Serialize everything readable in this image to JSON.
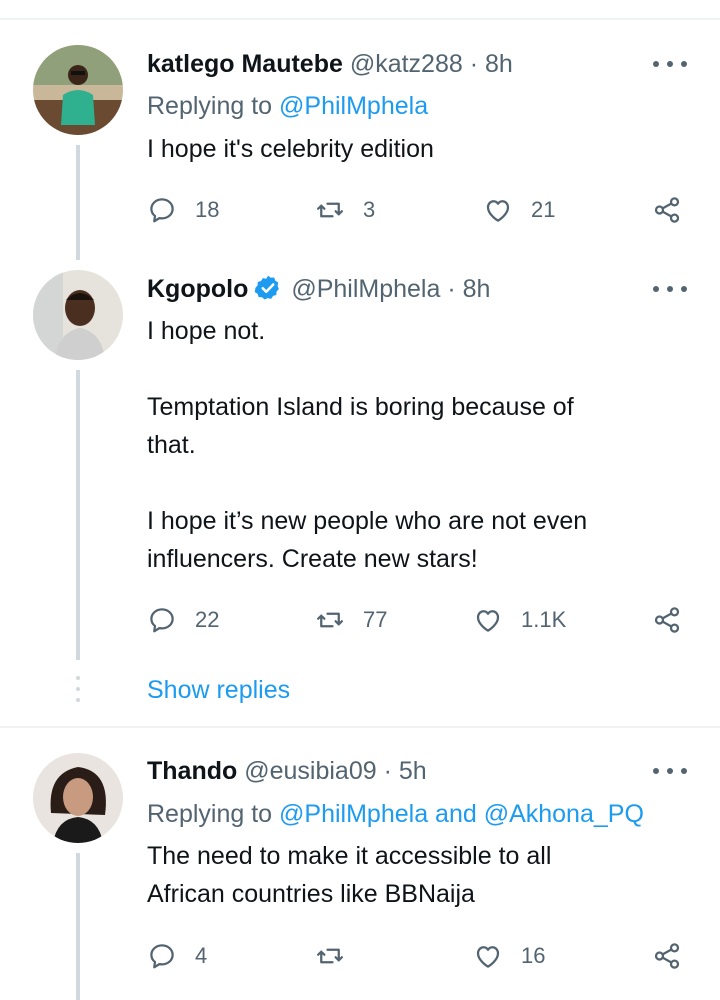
{
  "tweets": [
    {
      "name": "katlego Mautebe",
      "handle": "@katz288",
      "dot": "·",
      "time": "8h",
      "replying_prefix": "Replying to ",
      "replying_to": "@PhilMphela",
      "text": "I hope it's celebrity edition",
      "replies": "18",
      "retweets": "3",
      "likes": "21"
    },
    {
      "name": "Kgopolo",
      "handle": "@PhilMphela",
      "dot": "·",
      "time": "8h",
      "verified": true,
      "text": "I hope not.\n\nTemptation Island is boring because of\nthat.\n\nI hope it’s new people who are not even\ninfluencers. Create new stars!",
      "replies": "22",
      "retweets": "77",
      "likes": "1.1K"
    },
    {
      "name": "Thando",
      "handle": "@eusibia09",
      "dot": "·",
      "time": "5h",
      "replying_prefix": "Replying to ",
      "replying_to": "@PhilMphela and @Akhona_PQ",
      "text": "The need to make it accessible to all\nAfrican countries like BBNaija",
      "replies": "4",
      "retweets": "",
      "likes": "16"
    }
  ],
  "show_replies_label": "Show replies",
  "colors": {
    "accent": "#1d9bf0",
    "secondary_text": "#536471",
    "primary_text": "#0f1419",
    "thread_line": "#cfd9de"
  },
  "icons": [
    "more-icon",
    "reply-icon",
    "retweet-icon",
    "like-icon",
    "share-icon",
    "verified-badge-icon"
  ]
}
